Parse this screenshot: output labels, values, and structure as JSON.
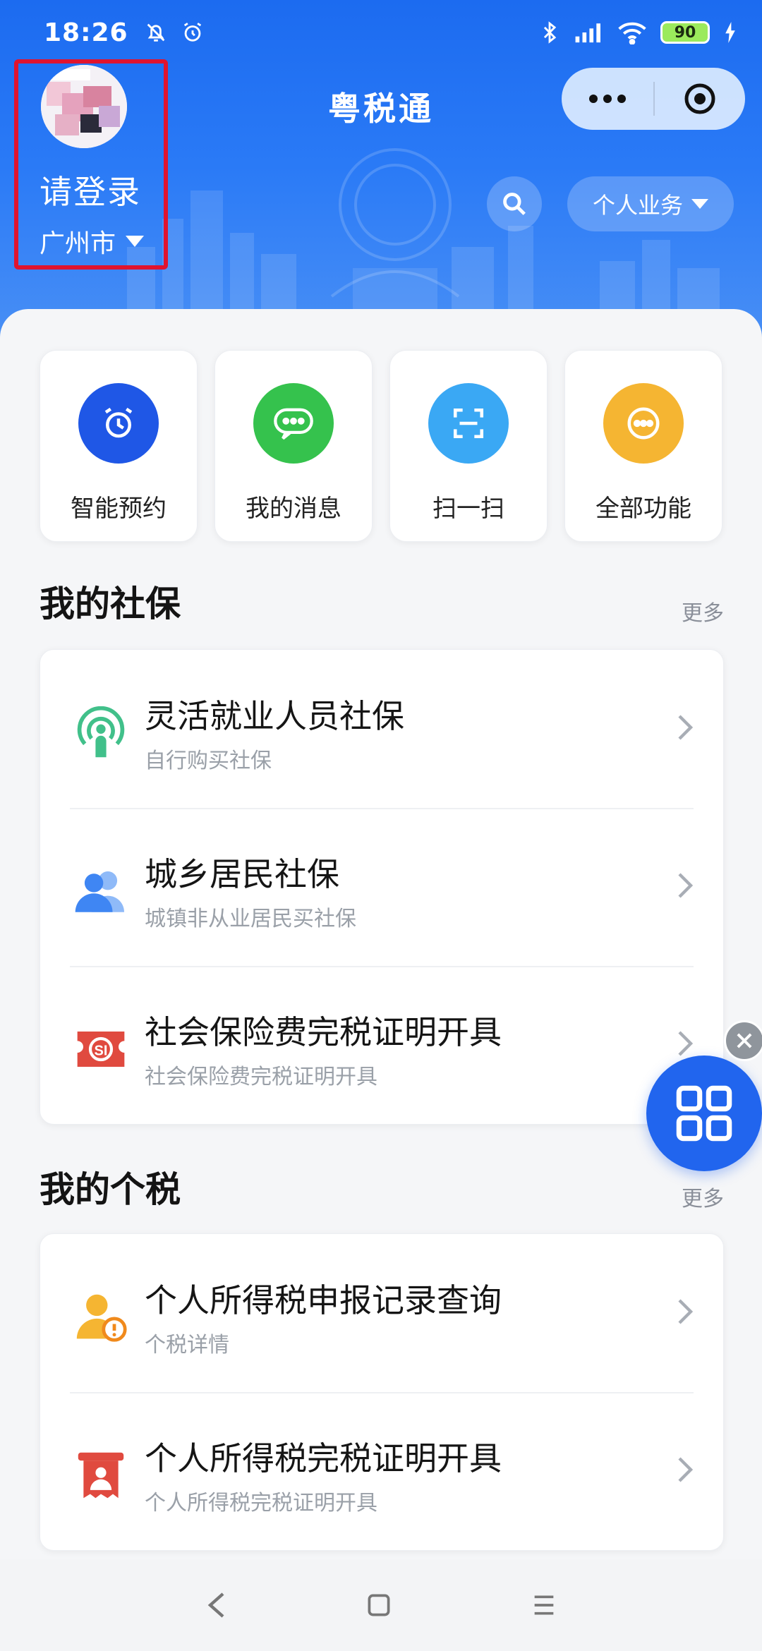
{
  "status_bar": {
    "time": "18:26",
    "battery": "90",
    "icons": [
      "alarm-off-icon",
      "alarm-clock-icon",
      "bluetooth-icon",
      "signal-hd-icon",
      "wifi-icon",
      "charging-icon"
    ]
  },
  "header": {
    "title": "粤税通",
    "login_text": "请登录",
    "city": "广州市",
    "business_label": "个人业务",
    "colors": {
      "primary": "#2a7af6",
      "highlight_box": "#e0142f"
    }
  },
  "quick_actions": [
    {
      "label": "智能预约",
      "icon": "alarm-clock-icon",
      "color": "#1f57e6"
    },
    {
      "label": "我的消息",
      "icon": "message-bubble-icon",
      "color": "#35c24d"
    },
    {
      "label": "扫一扫",
      "icon": "scan-icon",
      "color": "#3aa8f4"
    },
    {
      "label": "全部功能",
      "icon": "more-dots-icon",
      "color": "#f5b532"
    }
  ],
  "social_security": {
    "title": "我的社保",
    "more": "更多",
    "items": [
      {
        "title": "灵活就业人员社保",
        "subtitle": "自行购买社保",
        "icon": "flexible-worker-icon"
      },
      {
        "title": "城乡居民社保",
        "subtitle": "城镇非从业居民买社保",
        "icon": "residents-icon"
      },
      {
        "title": "社会保险费完税证明开具",
        "subtitle": "社会保险费完税证明开具",
        "icon": "si-certificate-icon"
      }
    ]
  },
  "personal_tax": {
    "title": "我的个税",
    "more": "更多",
    "items": [
      {
        "title": "个人所得税申报记录查询",
        "subtitle": "个税详情",
        "icon": "tax-query-icon"
      },
      {
        "title": "个人所得税完税证明开具",
        "subtitle": "个人所得税完税证明开具",
        "icon": "tax-certificate-icon"
      }
    ]
  },
  "navbar": {
    "icons": [
      "back-icon",
      "home-icon",
      "menu-icon"
    ]
  }
}
